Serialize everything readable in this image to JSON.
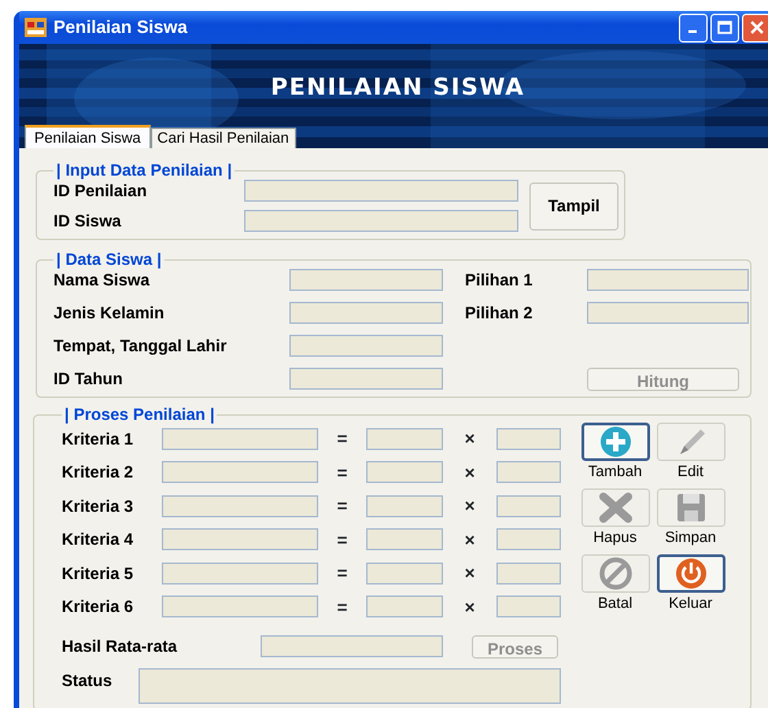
{
  "window": {
    "title": "Penilaian Siswa"
  },
  "banner": {
    "title": "PENILAIAN SISWA"
  },
  "tabs": [
    {
      "label": "Penilaian Siswa",
      "selected": true
    },
    {
      "label": "Cari Hasil Penilaian",
      "selected": false
    }
  ],
  "input_group": {
    "title": "| Input Data Penilaian |",
    "fields": [
      {
        "label": "ID Penilaian"
      },
      {
        "label": "ID Siswa"
      }
    ],
    "button": {
      "label": "Tampil",
      "disabled": false
    }
  },
  "data_group": {
    "title": "| Data Siswa |",
    "fields": [
      {
        "label": "Nama Siswa"
      },
      {
        "label": "Jenis Kelamin"
      },
      {
        "label": "Tempat, Tanggal Lahir"
      },
      {
        "label": "ID Tahun"
      }
    ],
    "choices": [
      {
        "label": "Pilihan 1"
      },
      {
        "label": "Pilihan 2"
      }
    ],
    "button": {
      "label": "Hitung",
      "disabled": true
    }
  },
  "process_group": {
    "title": "| Proses Penilaian |",
    "criteria": [
      {
        "label": "Kriteria 1",
        "equals_sign": "=",
        "times_sign": "×"
      },
      {
        "label": "Kriteria 2",
        "equals_sign": "=",
        "times_sign": "×"
      },
      {
        "label": "Kriteria 3",
        "equals_sign": "=",
        "times_sign": "×"
      },
      {
        "label": "Kriteria 4",
        "equals_sign": "=",
        "times_sign": "×"
      },
      {
        "label": "Kriteria 5",
        "equals_sign": "=",
        "times_sign": "×"
      },
      {
        "label": "Kriteria 6",
        "equals_sign": "=",
        "times_sign": "×"
      }
    ],
    "actions": [
      {
        "label": "Tambah",
        "kind": "add",
        "disabled": false
      },
      {
        "label": "Edit",
        "kind": "edit",
        "disabled": true
      },
      {
        "label": "Hapus",
        "kind": "delete",
        "disabled": true
      },
      {
        "label": "Simpan",
        "kind": "save",
        "disabled": true
      },
      {
        "label": "Batal",
        "kind": "cancel",
        "disabled": true
      },
      {
        "label": "Keluar",
        "kind": "exit",
        "disabled": false
      }
    ],
    "average": {
      "label": "Hasil Rata-rata"
    },
    "process_button": {
      "label": "Proses",
      "disabled": true
    },
    "status": {
      "label": "Status"
    }
  }
}
